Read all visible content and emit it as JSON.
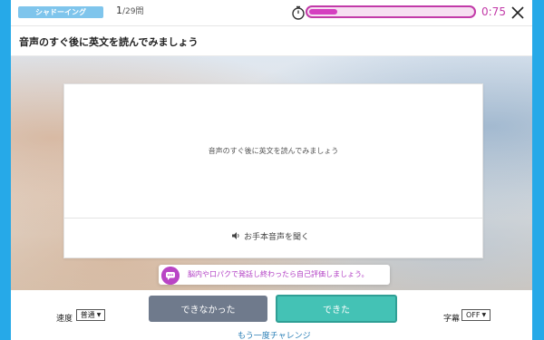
{
  "header": {
    "mode_label": "シャドーイング",
    "counter_current": "1",
    "counter_total": "/29問",
    "timer_value": "0:75",
    "timer_progress": 0.17,
    "close_icon": "close-icon"
  },
  "instruction": {
    "text": "音声のすぐ後に英文を読んでみましょう"
  },
  "card": {
    "text": "音声のすぐ後に英文を読んでみましょう",
    "listen_label": "お手本音声を聞く",
    "listen_icon": "speaker-icon"
  },
  "toast": {
    "text": "脳内や口パクで発話し終わったら自己評価しましょう。",
    "icon": "chat-bubble-icon"
  },
  "controls": {
    "speed_label": "速度",
    "speed_value": "普通",
    "fail_label": "できなかった",
    "ok_label": "できた",
    "retry_label": "もう一度チャレンジ",
    "subtitle_label": "字幕",
    "subtitle_value": "OFF"
  },
  "colors": {
    "frame": "#26a9e8",
    "accent_magenta": "#c23aa8",
    "ok_button": "#44c2b5",
    "fail_button": "#6f7a8c"
  }
}
